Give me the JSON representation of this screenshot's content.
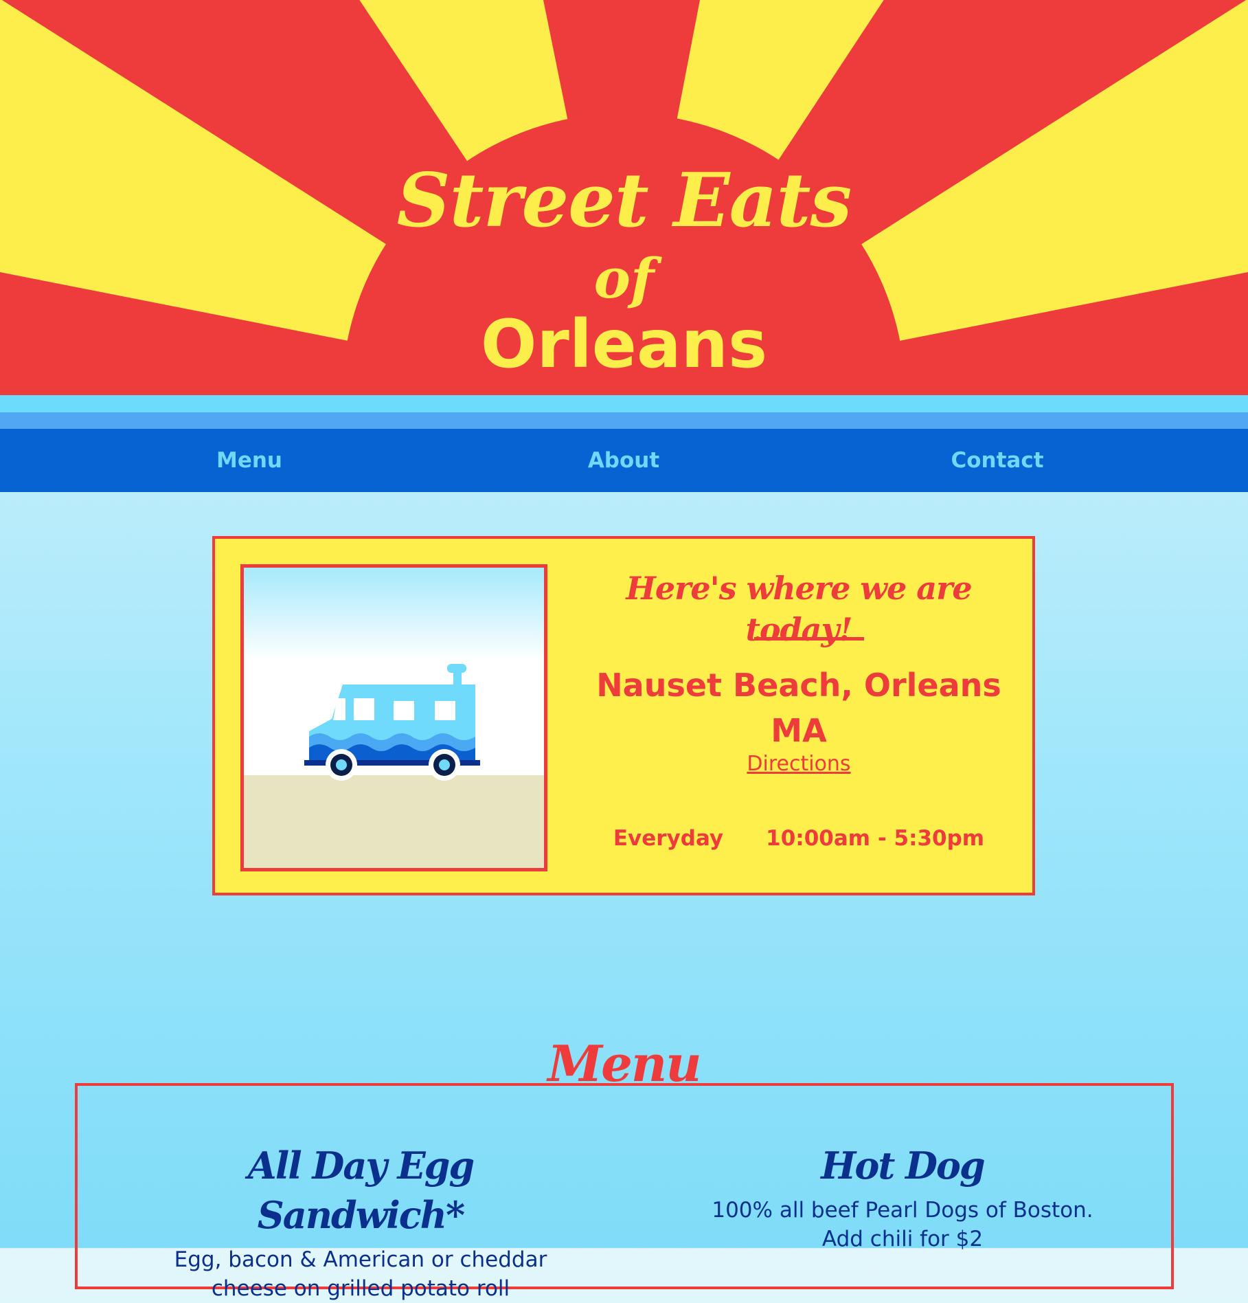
{
  "colors": {
    "red": "#ee3c3c",
    "yellow": "#fdee4c",
    "nav_blue": "#0762d2",
    "nav_text": "#70d8fb",
    "menu_text": "#0a2f8c"
  },
  "hero": {
    "title_line1": "Street Eats",
    "title_line2": "of",
    "title_line3": "Orleans"
  },
  "nav": {
    "items": [
      {
        "label": "Menu"
      },
      {
        "label": "About"
      },
      {
        "label": "Contact"
      }
    ]
  },
  "location": {
    "heading": "Here's where we are today!",
    "place": "Nauset Beach, Orleans MA",
    "directions_label": "Directions",
    "hours_day": "Everyday",
    "hours_time": "10:00am - 5:30pm",
    "image_icon": "food-truck-on-beach-illustration"
  },
  "menu": {
    "title": "Menu",
    "items": [
      {
        "name": "All Day Egg Sandwich*",
        "desc_line1": "Egg, bacon & American or cheddar",
        "desc_line2": "cheese on grilled potato roll"
      },
      {
        "name": "Hot Dog",
        "desc_line1": "100% all beef Pearl Dogs of Boston.",
        "desc_line2": "Add chili for $2"
      }
    ]
  }
}
